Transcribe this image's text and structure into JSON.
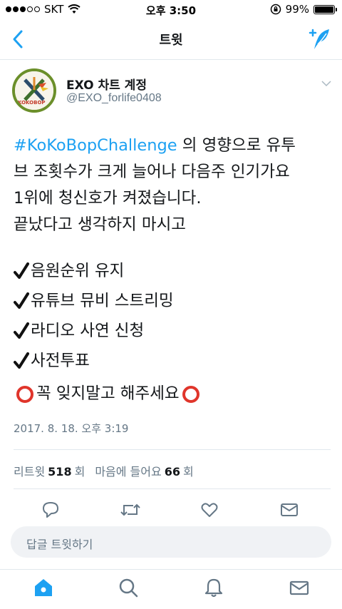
{
  "status_bar": {
    "carrier": "SKT",
    "time": "오후 3:50",
    "battery": "99%",
    "battery_level": 0.99
  },
  "navbar": {
    "title": "트윗"
  },
  "tweet": {
    "author_name": "EXO 차트 계정",
    "author_handle": "@EXO_forlife0408",
    "hashtag": "#KoKoBopChallenge",
    "lines": [
      " 의 영향으로 유투",
      "브 조횟수가 크게 늘어나 다음주 인기가요",
      "1위에 청신호가 켜졌습니다.",
      "끝났다고 생각하지 마시고"
    ],
    "checklist": [
      "음원순위 유지",
      "유튜브 뮤비 스트리밍",
      "라디오 사연 신청",
      "사전투표"
    ],
    "closing": "꼭 잊지말고 해주세요",
    "timestamp": "2017. 8. 18. 오후 3:19",
    "retweets_label": "리트윗",
    "retweets_count": "518",
    "retweets_unit": "회",
    "likes_label": "마음에 들어요",
    "likes_count": "66",
    "likes_unit": "회"
  },
  "reply": {
    "placeholder": "답글 트윗하기"
  },
  "colors": {
    "accent": "#1da1f2",
    "muted": "#657786",
    "red": "#e0352b"
  },
  "icons": {
    "back": "chevron-left-icon",
    "compose": "compose-tweet-icon",
    "reply": "reply-icon",
    "retweet": "retweet-icon",
    "like": "heart-icon",
    "dm": "mail-icon",
    "home": "home-icon",
    "search": "search-icon",
    "notifications": "bell-icon",
    "messages": "envelope-icon"
  }
}
